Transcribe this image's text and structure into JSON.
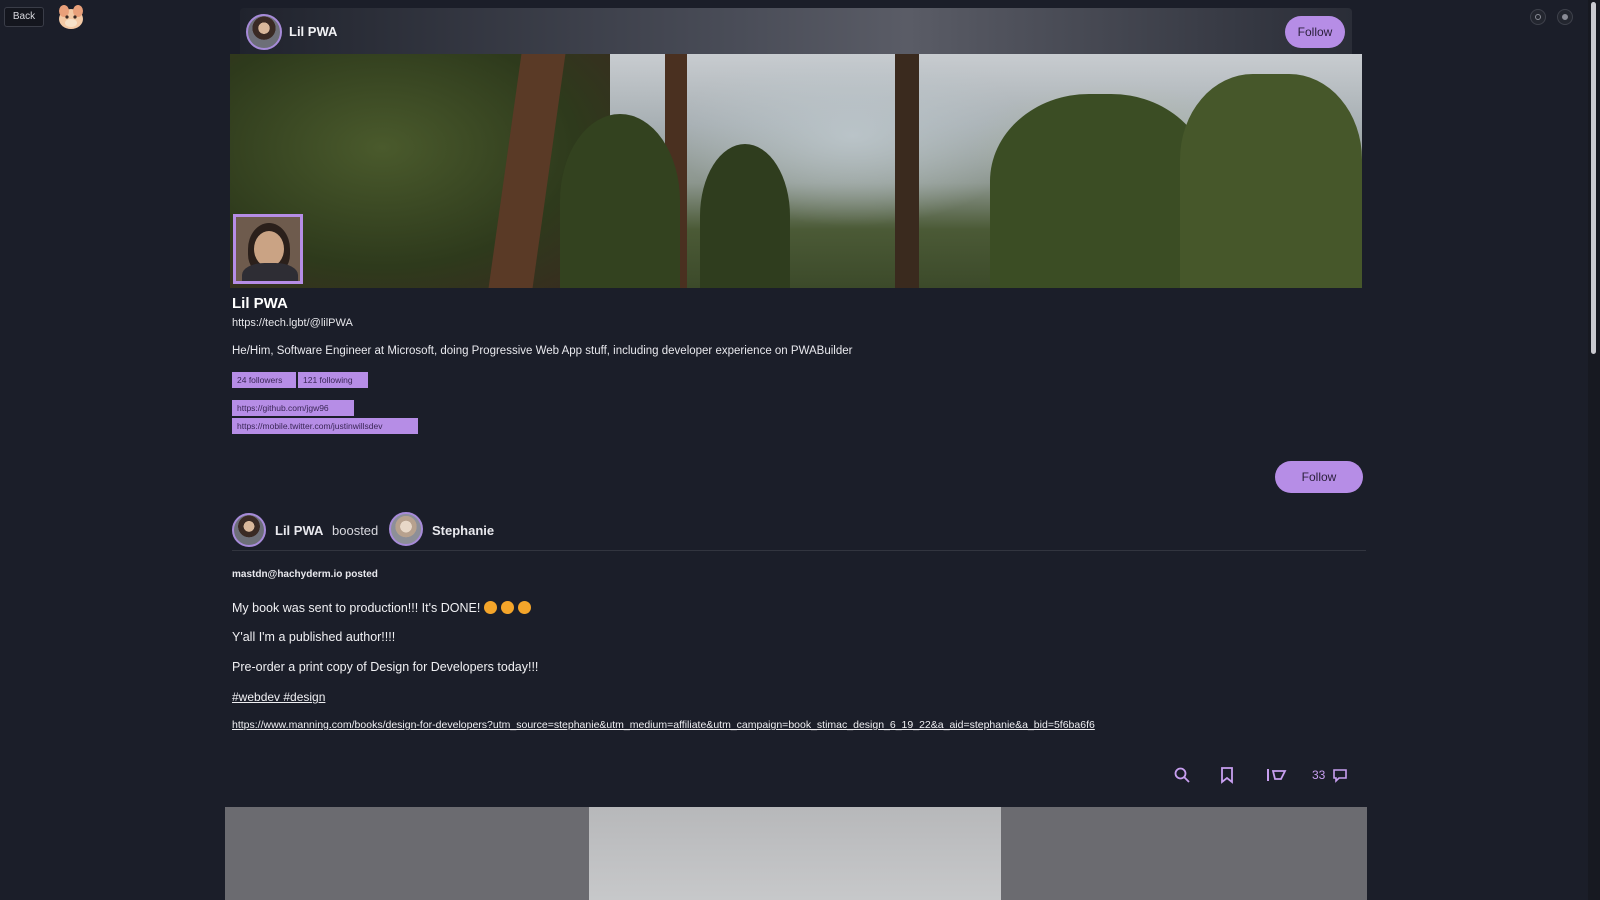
{
  "nav": {
    "back_label": "Back"
  },
  "header": {
    "display_name": "Lil PWA",
    "follow_label": "Follow"
  },
  "profile": {
    "display_name": "Lil PWA",
    "handle_url": "https://tech.lgbt/@lilPWA",
    "bio": "He/Him, Software Engineer at Microsoft, doing Progressive Web App stuff, including developer experience on PWABuilder",
    "followers_label": "24 followers",
    "following_label": "121 following",
    "links": [
      "https://github.com/jgw96",
      "https://mobile.twitter.com/justinwillsdev"
    ],
    "follow_label": "Follow"
  },
  "post": {
    "booster_name": "Lil PWA",
    "boost_verb": "boosted",
    "author_name": "Stephanie",
    "source_line": "mastdn@hachyderm.io posted",
    "lines": [
      "My book was sent to production!!! It's DONE!",
      "Y'all I'm a published author!!!!",
      "Pre-order a print copy of Design for Developers today!!!"
    ],
    "tags": "#webdev #design",
    "link": "https://www.manning.com/books/design-for-developers?utm_source=stephanie&utm_medium=affiliate&utm_campaign=book_stimac_design_6_19_22&a_aid=stephanie&a_bid=5f6ba6f6",
    "reply_count": "33"
  },
  "icons": {
    "logo": "app-logo-icon",
    "window": [
      "settings-icon",
      "account-icon"
    ],
    "actions": [
      "search-icon",
      "bookmark-icon",
      "boost-icon",
      "reply-icon"
    ]
  },
  "colors": {
    "background": "#1b1e29",
    "accent": "#b68de6",
    "action": "#c89ff0"
  }
}
